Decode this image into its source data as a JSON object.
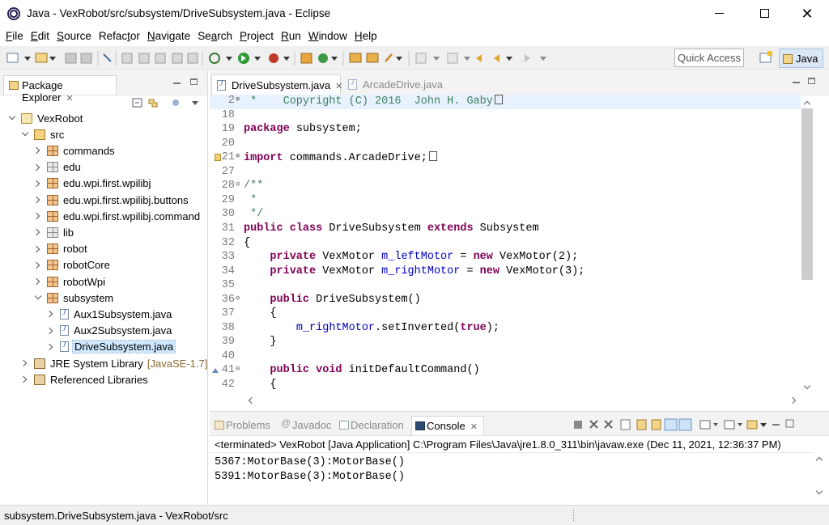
{
  "window": {
    "title": "Java - VexRobot/src/subsystem/DriveSubsystem.java - Eclipse",
    "close_glyph": "✕"
  },
  "menu": [
    {
      "mnemonic": "F",
      "rest": "ile"
    },
    {
      "mnemonic": "E",
      "rest": "dit"
    },
    {
      "mnemonic": "S",
      "rest": "ource"
    },
    {
      "pre": "Refac",
      "mnemonic": "t",
      "rest": "or"
    },
    {
      "mnemonic": "N",
      "rest": "avigate"
    },
    {
      "pre": "Se",
      "mnemonic": "a",
      "rest": "rch"
    },
    {
      "mnemonic": "P",
      "rest": "roject"
    },
    {
      "mnemonic": "R",
      "rest": "un"
    },
    {
      "mnemonic": "W",
      "rest": "indow"
    },
    {
      "mnemonic": "H",
      "rest": "elp"
    }
  ],
  "toolbar": {
    "quick_access_label": "Quick Access",
    "perspective_label": "Java"
  },
  "package_explorer": {
    "tab_label": "Package Explorer",
    "close_glyph": "✕",
    "tree": [
      {
        "label": "VexRobot",
        "icon": "project-icon",
        "level": 0,
        "state": "expanded"
      },
      {
        "label": "src",
        "icon": "source-folder-icon",
        "level": 1,
        "state": "expanded"
      },
      {
        "label": "commands",
        "icon": "package-icon",
        "level": 2,
        "state": "collapsed"
      },
      {
        "label": "edu",
        "icon": "empty-package-icon",
        "level": 2,
        "state": "collapsed"
      },
      {
        "label": "edu.wpi.first.wpilibj",
        "icon": "package-icon",
        "level": 2,
        "state": "collapsed"
      },
      {
        "label": "edu.wpi.first.wpilibj.buttons",
        "icon": "package-icon",
        "level": 2,
        "state": "collapsed"
      },
      {
        "label": "edu.wpi.first.wpilibj.command",
        "icon": "package-icon",
        "level": 2,
        "state": "collapsed"
      },
      {
        "label": "lib",
        "icon": "empty-package-icon",
        "level": 2,
        "state": "collapsed"
      },
      {
        "label": "robot",
        "icon": "package-icon",
        "level": 2,
        "state": "collapsed"
      },
      {
        "label": "robotCore",
        "icon": "package-icon",
        "level": 2,
        "state": "collapsed"
      },
      {
        "label": "robotWpi",
        "icon": "package-icon",
        "level": 2,
        "state": "collapsed"
      },
      {
        "label": "subsystem",
        "icon": "package-icon",
        "level": 2,
        "state": "expanded"
      },
      {
        "label": "Aux1Subsystem.java",
        "icon": "java-file-icon",
        "level": 3,
        "state": "collapsed"
      },
      {
        "label": "Aux2Subsystem.java",
        "icon": "java-file-icon",
        "level": 3,
        "state": "collapsed"
      },
      {
        "label": "DriveSubsystem.java",
        "icon": "java-file-icon",
        "level": 3,
        "state": "collapsed",
        "selected": true
      },
      {
        "label": "JRE System Library",
        "suffix": "[JavaSE-1.7]",
        "icon": "library-icon",
        "level": 1,
        "state": "collapsed"
      },
      {
        "label": "Referenced Libraries",
        "icon": "library-icon",
        "level": 1,
        "state": "collapsed"
      }
    ]
  },
  "editor": {
    "tabs": [
      {
        "label": "DriveSubsystem.java",
        "active": true,
        "close_glyph": "✕"
      },
      {
        "label": "ArcadeDrive.java",
        "active": false
      }
    ],
    "lines": [
      {
        "num": "2",
        "fold": "⊕",
        "highlight": true,
        "tokens": [
          {
            "t": " *    Copyright (C) 2016  John H. Gaby",
            "c": "cm"
          }
        ],
        "box": true
      },
      {
        "num": "18",
        "tokens": []
      },
      {
        "num": "19",
        "tokens": [
          {
            "t": "package",
            "c": "kw"
          },
          {
            "t": " subsystem;"
          }
        ]
      },
      {
        "num": "20",
        "tokens": []
      },
      {
        "num": "21",
        "fold": "⊕",
        "warn": true,
        "tokens": [
          {
            "t": "import",
            "c": "kw"
          },
          {
            "t": " commands.ArcadeDrive;"
          }
        ],
        "box": true
      },
      {
        "num": "27",
        "tokens": []
      },
      {
        "num": "28",
        "fold": "⊖",
        "tokens": [
          {
            "t": "/**",
            "c": "cm"
          }
        ]
      },
      {
        "num": "29",
        "tokens": [
          {
            "t": " *",
            "c": "cm"
          }
        ]
      },
      {
        "num": "30",
        "tokens": [
          {
            "t": " */",
            "c": "cm"
          }
        ]
      },
      {
        "num": "31",
        "tokens": [
          {
            "t": "public",
            "c": "kw"
          },
          {
            "t": " "
          },
          {
            "t": "class",
            "c": "kw"
          },
          {
            "t": " DriveSubsystem "
          },
          {
            "t": "extends",
            "c": "kw"
          },
          {
            "t": " Subsystem"
          }
        ]
      },
      {
        "num": "32",
        "tokens": [
          {
            "t": "{"
          }
        ]
      },
      {
        "num": "33",
        "tokens": [
          {
            "t": "    "
          },
          {
            "t": "private",
            "c": "kw"
          },
          {
            "t": " VexMotor "
          },
          {
            "t": "m_leftMotor",
            "c": "fld"
          },
          {
            "t": " = "
          },
          {
            "t": "new",
            "c": "kw"
          },
          {
            "t": " VexMotor(2);"
          }
        ]
      },
      {
        "num": "34",
        "tokens": [
          {
            "t": "    "
          },
          {
            "t": "private",
            "c": "kw"
          },
          {
            "t": " VexMotor "
          },
          {
            "t": "m_rightMotor",
            "c": "fld"
          },
          {
            "t": " = "
          },
          {
            "t": "new",
            "c": "kw"
          },
          {
            "t": " VexMotor(3);"
          }
        ]
      },
      {
        "num": "35",
        "tokens": []
      },
      {
        "num": "36",
        "fold": "⊖",
        "tokens": [
          {
            "t": "    "
          },
          {
            "t": "public",
            "c": "kw"
          },
          {
            "t": " DriveSubsystem()"
          }
        ]
      },
      {
        "num": "37",
        "tokens": [
          {
            "t": "    {"
          }
        ]
      },
      {
        "num": "38",
        "tokens": [
          {
            "t": "        "
          },
          {
            "t": "m_rightMotor",
            "c": "fld"
          },
          {
            "t": ".setInverted("
          },
          {
            "t": "true",
            "c": "kw"
          },
          {
            "t": ");"
          }
        ]
      },
      {
        "num": "39",
        "tokens": [
          {
            "t": "    }"
          }
        ]
      },
      {
        "num": "40",
        "tokens": []
      },
      {
        "num": "41",
        "fold": "⊖",
        "override": true,
        "tokens": [
          {
            "t": "    "
          },
          {
            "t": "public",
            "c": "kw"
          },
          {
            "t": " "
          },
          {
            "t": "void",
            "c": "kw"
          },
          {
            "t": " initDefaultCommand()"
          }
        ]
      },
      {
        "num": "42",
        "tokens": [
          {
            "t": "    {"
          }
        ]
      }
    ]
  },
  "console_panel": {
    "tabs": [
      {
        "label": "Problems",
        "active": false
      },
      {
        "label": "Javadoc",
        "active": false
      },
      {
        "label": "Declaration",
        "active": false
      },
      {
        "label": "Console",
        "active": true,
        "close_glyph": "✕"
      }
    ],
    "header": "<terminated> VexRobot [Java Application] C:\\Program Files\\Java\\jre1.8.0_311\\bin\\javaw.exe (Dec 11, 2021, 12:36:37 PM)",
    "lines": [
      "5367:MotorBase(3):MotorBase()",
      "5391:MotorBase(3):MotorBase()"
    ]
  },
  "status_bar": {
    "text": "subsystem.DriveSubsystem.java - VexRobot/src"
  }
}
